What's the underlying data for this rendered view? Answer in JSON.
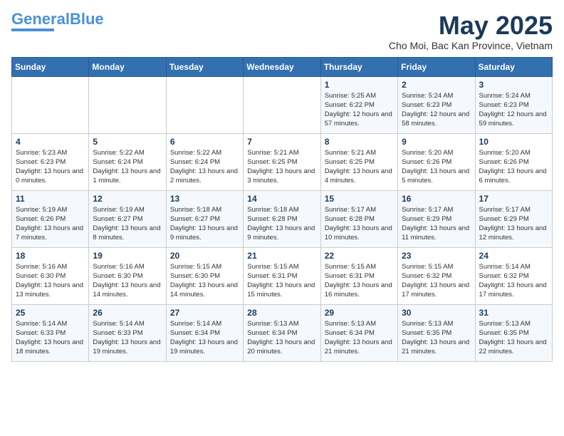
{
  "logo": {
    "line1": "General",
    "line2": "Blue"
  },
  "title": "May 2025",
  "subtitle": "Cho Moi, Bac Kan Province, Vietnam",
  "days_of_week": [
    "Sunday",
    "Monday",
    "Tuesday",
    "Wednesday",
    "Thursday",
    "Friday",
    "Saturday"
  ],
  "weeks": [
    [
      {
        "num": "",
        "info": ""
      },
      {
        "num": "",
        "info": ""
      },
      {
        "num": "",
        "info": ""
      },
      {
        "num": "",
        "info": ""
      },
      {
        "num": "1",
        "info": "Sunrise: 5:25 AM\nSunset: 6:22 PM\nDaylight: 12 hours and 57 minutes."
      },
      {
        "num": "2",
        "info": "Sunrise: 5:24 AM\nSunset: 6:23 PM\nDaylight: 12 hours and 58 minutes."
      },
      {
        "num": "3",
        "info": "Sunrise: 5:24 AM\nSunset: 6:23 PM\nDaylight: 12 hours and 59 minutes."
      }
    ],
    [
      {
        "num": "4",
        "info": "Sunrise: 5:23 AM\nSunset: 6:23 PM\nDaylight: 13 hours and 0 minutes."
      },
      {
        "num": "5",
        "info": "Sunrise: 5:22 AM\nSunset: 6:24 PM\nDaylight: 13 hours and 1 minute."
      },
      {
        "num": "6",
        "info": "Sunrise: 5:22 AM\nSunset: 6:24 PM\nDaylight: 13 hours and 2 minutes."
      },
      {
        "num": "7",
        "info": "Sunrise: 5:21 AM\nSunset: 6:25 PM\nDaylight: 13 hours and 3 minutes."
      },
      {
        "num": "8",
        "info": "Sunrise: 5:21 AM\nSunset: 6:25 PM\nDaylight: 13 hours and 4 minutes."
      },
      {
        "num": "9",
        "info": "Sunrise: 5:20 AM\nSunset: 6:26 PM\nDaylight: 13 hours and 5 minutes."
      },
      {
        "num": "10",
        "info": "Sunrise: 5:20 AM\nSunset: 6:26 PM\nDaylight: 13 hours and 6 minutes."
      }
    ],
    [
      {
        "num": "11",
        "info": "Sunrise: 5:19 AM\nSunset: 6:26 PM\nDaylight: 13 hours and 7 minutes."
      },
      {
        "num": "12",
        "info": "Sunrise: 5:19 AM\nSunset: 6:27 PM\nDaylight: 13 hours and 8 minutes."
      },
      {
        "num": "13",
        "info": "Sunrise: 5:18 AM\nSunset: 6:27 PM\nDaylight: 13 hours and 9 minutes."
      },
      {
        "num": "14",
        "info": "Sunrise: 5:18 AM\nSunset: 6:28 PM\nDaylight: 13 hours and 9 minutes."
      },
      {
        "num": "15",
        "info": "Sunrise: 5:17 AM\nSunset: 6:28 PM\nDaylight: 13 hours and 10 minutes."
      },
      {
        "num": "16",
        "info": "Sunrise: 5:17 AM\nSunset: 6:29 PM\nDaylight: 13 hours and 11 minutes."
      },
      {
        "num": "17",
        "info": "Sunrise: 5:17 AM\nSunset: 6:29 PM\nDaylight: 13 hours and 12 minutes."
      }
    ],
    [
      {
        "num": "18",
        "info": "Sunrise: 5:16 AM\nSunset: 6:30 PM\nDaylight: 13 hours and 13 minutes."
      },
      {
        "num": "19",
        "info": "Sunrise: 5:16 AM\nSunset: 6:30 PM\nDaylight: 13 hours and 14 minutes."
      },
      {
        "num": "20",
        "info": "Sunrise: 5:15 AM\nSunset: 6:30 PM\nDaylight: 13 hours and 14 minutes."
      },
      {
        "num": "21",
        "info": "Sunrise: 5:15 AM\nSunset: 6:31 PM\nDaylight: 13 hours and 15 minutes."
      },
      {
        "num": "22",
        "info": "Sunrise: 5:15 AM\nSunset: 6:31 PM\nDaylight: 13 hours and 16 minutes."
      },
      {
        "num": "23",
        "info": "Sunrise: 5:15 AM\nSunset: 6:32 PM\nDaylight: 13 hours and 17 minutes."
      },
      {
        "num": "24",
        "info": "Sunrise: 5:14 AM\nSunset: 6:32 PM\nDaylight: 13 hours and 17 minutes."
      }
    ],
    [
      {
        "num": "25",
        "info": "Sunrise: 5:14 AM\nSunset: 6:33 PM\nDaylight: 13 hours and 18 minutes."
      },
      {
        "num": "26",
        "info": "Sunrise: 5:14 AM\nSunset: 6:33 PM\nDaylight: 13 hours and 19 minutes."
      },
      {
        "num": "27",
        "info": "Sunrise: 5:14 AM\nSunset: 6:34 PM\nDaylight: 13 hours and 19 minutes."
      },
      {
        "num": "28",
        "info": "Sunrise: 5:13 AM\nSunset: 6:34 PM\nDaylight: 13 hours and 20 minutes."
      },
      {
        "num": "29",
        "info": "Sunrise: 5:13 AM\nSunset: 6:34 PM\nDaylight: 13 hours and 21 minutes."
      },
      {
        "num": "30",
        "info": "Sunrise: 5:13 AM\nSunset: 6:35 PM\nDaylight: 13 hours and 21 minutes."
      },
      {
        "num": "31",
        "info": "Sunrise: 5:13 AM\nSunset: 6:35 PM\nDaylight: 13 hours and 22 minutes."
      }
    ]
  ]
}
